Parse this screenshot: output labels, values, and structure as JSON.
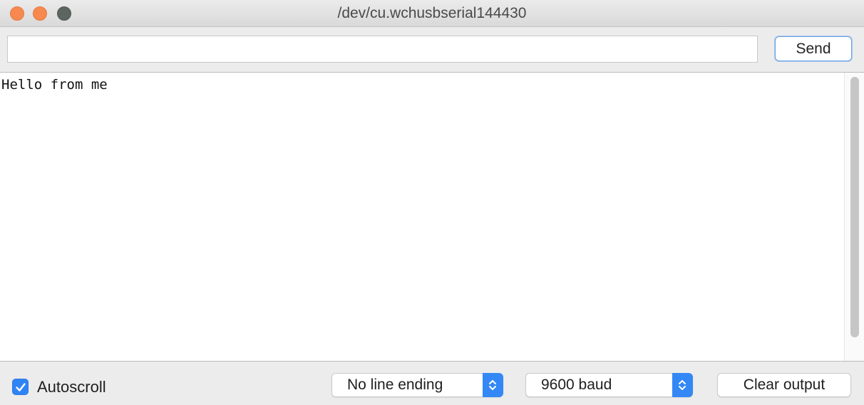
{
  "window": {
    "title": "/dev/cu.wchusbserial144430"
  },
  "send_row": {
    "input_value": "",
    "send_label": "Send"
  },
  "output": {
    "text": "Hello from me"
  },
  "bottom_bar": {
    "autoscroll_label": "Autoscroll",
    "autoscroll_checked": true,
    "line_ending_selected": "No line ending",
    "baud_selected": "9600 baud",
    "clear_label": "Clear output"
  },
  "colors": {
    "accent_blue": "#3388f5",
    "traffic_close": "#f7894f",
    "traffic_minimize": "#f7894f",
    "traffic_zoom": "#5d6561"
  },
  "icons": {
    "checkbox": "checkmark-icon",
    "stepper": "chevron-up-down-icon"
  }
}
